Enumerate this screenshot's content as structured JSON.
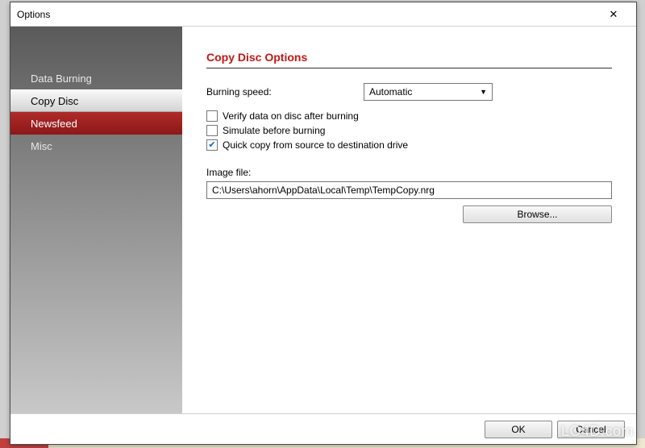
{
  "window": {
    "title": "Options"
  },
  "sidebar": {
    "items": [
      {
        "label": "Data Burning",
        "state": "normal"
      },
      {
        "label": "Copy Disc",
        "state": "selected"
      },
      {
        "label": "Newsfeed",
        "state": "highlight"
      },
      {
        "label": "Misc",
        "state": "normal"
      }
    ]
  },
  "content": {
    "section_title": "Copy Disc Options",
    "speed_label": "Burning speed:",
    "speed_value": "Automatic",
    "checkboxes": [
      {
        "label": "Verify data on disc after burning",
        "checked": false
      },
      {
        "label": "Simulate before burning",
        "checked": false
      },
      {
        "label": "Quick copy from source to destination drive",
        "checked": true
      }
    ],
    "image_label": "Image file:",
    "image_value": "C:\\Users\\ahorn\\AppData\\Local\\Temp\\TempCopy.nrg",
    "browse_label": "Browse..."
  },
  "footer": {
    "ok": "OK",
    "cancel": "Cancel"
  },
  "watermark": "LO4D.com"
}
